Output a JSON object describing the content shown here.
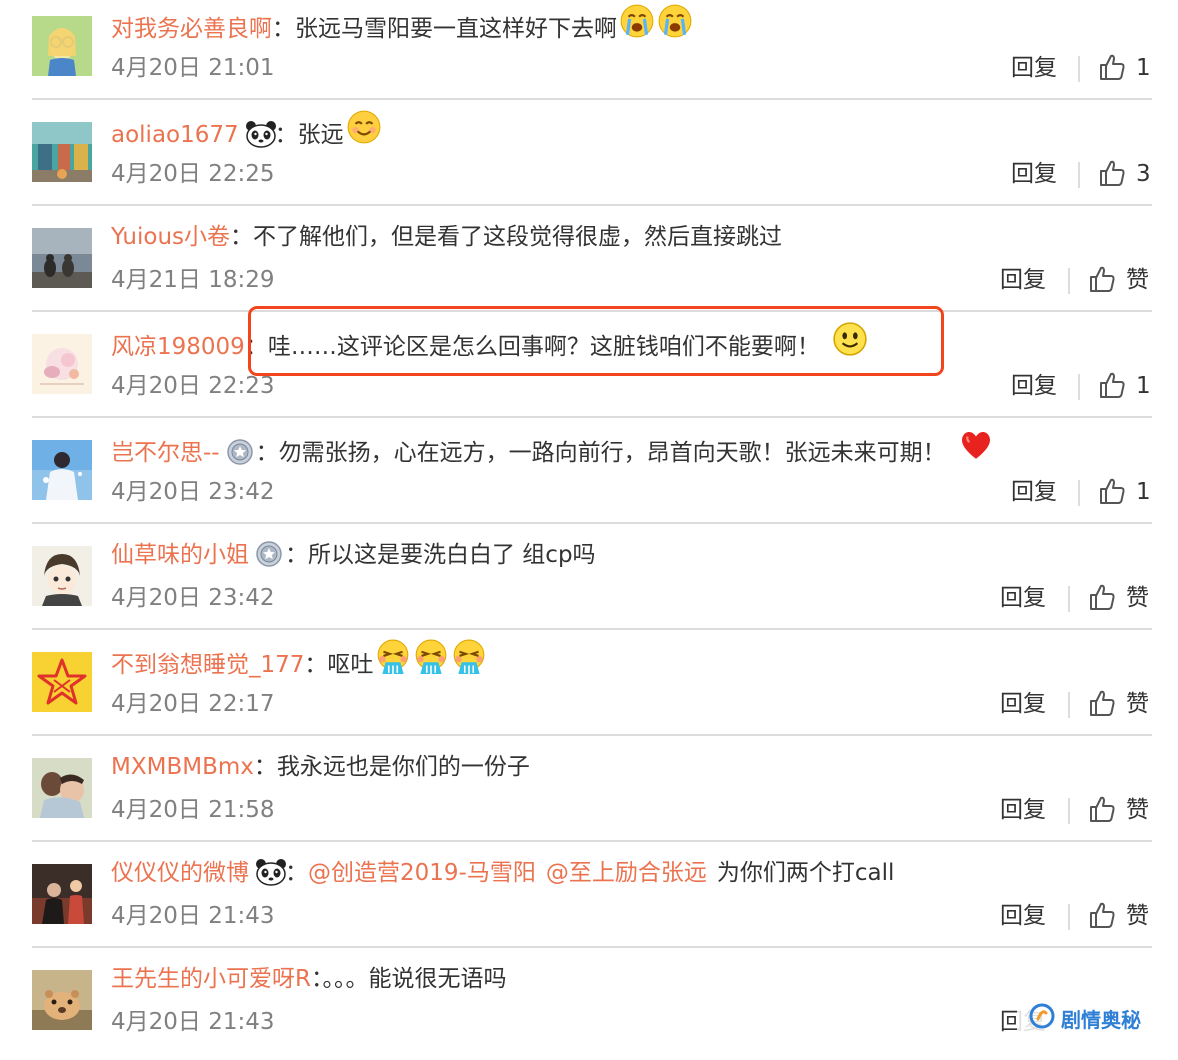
{
  "comments": [
    {
      "username": "对我务必善良啊",
      "colon": "：",
      "badge": "",
      "mentions": [],
      "text": "张远马雪阳要一直这样好下去啊",
      "emojis": [
        "crying-face-icon",
        "crying-face-icon"
      ],
      "time": "4月20日 21:01",
      "reply_label": "回复",
      "like_label": "1"
    },
    {
      "username": "aoliao1677",
      "colon": "：",
      "badge": "panda-badge-icon",
      "mentions": [],
      "text": "张远",
      "emojis": [
        "smiling-face-icon"
      ],
      "time": "4月20日 22:25",
      "reply_label": "回复",
      "like_label": "3"
    },
    {
      "username": "Yuious小卷",
      "colon": "：",
      "badge": "",
      "mentions": [],
      "text": "不了解他们，但是看了这段觉得很虚，然后直接跳过",
      "emojis": [],
      "time": "4月21日 18:29",
      "reply_label": "回复",
      "like_label": "赞"
    },
    {
      "username": "风凉198009",
      "colon": "：",
      "badge": "",
      "mentions": [],
      "text": "哇……这评论区是怎么回事啊？这脏钱咱们不能要啊！",
      "emojis": [
        "smiley-face-icon"
      ],
      "time": "4月20日 22:23",
      "reply_label": "回复",
      "like_label": "1"
    },
    {
      "username": "岂不尔思--",
      "colon": "：",
      "badge": "medal-badge-icon",
      "mentions": [],
      "text": "勿需张扬，心在远方，一路向前行，昂首向天歌！张远未来可期！",
      "emojis": [
        "heart-icon"
      ],
      "time": "4月20日 23:42",
      "reply_label": "回复",
      "like_label": "1"
    },
    {
      "username": "仙草味的小姐",
      "colon": "：",
      "badge": "medal-badge-icon",
      "mentions": [],
      "text": "所以这是要洗白白了 组cp吗",
      "emojis": [],
      "time": "4月20日 23:42",
      "reply_label": "回复",
      "like_label": "赞"
    },
    {
      "username": "不到翁想睡觉_177",
      "colon": "：",
      "badge": "",
      "mentions": [],
      "text": "呕吐",
      "emojis": [
        "vomit-face-icon",
        "vomit-face-icon",
        "vomit-face-icon"
      ],
      "time": "4月20日 22:17",
      "reply_label": "回复",
      "like_label": "赞"
    },
    {
      "username": "MXMBMBmx",
      "colon": "：",
      "badge": "",
      "mentions": [],
      "text": "我永远也是你们的一份子",
      "emojis": [],
      "time": "4月20日 21:58",
      "reply_label": "回复",
      "like_label": "赞"
    },
    {
      "username": "仪仪仪的微博",
      "colon": "：",
      "badge": "panda-badge-icon",
      "mentions": [
        "@创造营2019-马雪阳",
        "@至上励合张远"
      ],
      "text": "为你们两个打call",
      "emojis": [],
      "time": "4月20日 21:43",
      "reply_label": "回复",
      "like_label": "赞"
    },
    {
      "username": "王先生的小可爱呀R",
      "colon": "：",
      "badge": "",
      "mentions": [],
      "text": "。。。能说很无语吗",
      "emojis": [],
      "time": "4月20日 21:43",
      "reply_label": "回复",
      "like_label": ""
    }
  ],
  "watermark": {
    "text": "剧情奥秘"
  },
  "colors": {
    "username": "#eb7350",
    "highlight_box": "#f2441d",
    "watermark": "#2f7fd6"
  }
}
